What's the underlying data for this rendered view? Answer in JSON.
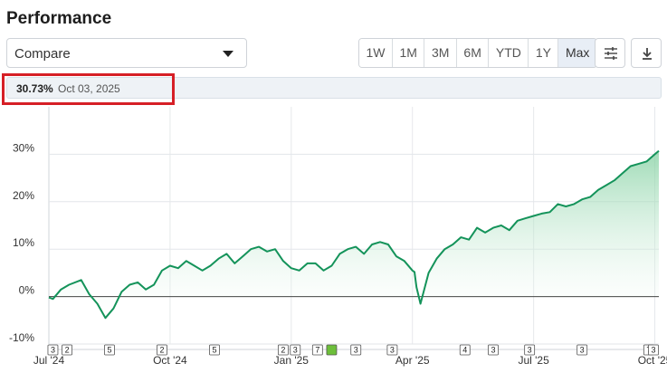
{
  "header": {
    "title": "Performance"
  },
  "compare": {
    "label": "Compare"
  },
  "range_buttons": [
    {
      "label": "1W",
      "active": false
    },
    {
      "label": "1M",
      "active": false
    },
    {
      "label": "3M",
      "active": false
    },
    {
      "label": "6M",
      "active": false
    },
    {
      "label": "YTD",
      "active": false
    },
    {
      "label": "1Y",
      "active": false
    },
    {
      "label": "Max",
      "active": true
    }
  ],
  "toolbar": {
    "settings_icon": "sliders-icon",
    "download_icon": "download-icon"
  },
  "readout": {
    "value": "30.73%",
    "date": "Oct 03, 2025"
  },
  "colors": {
    "line": "#14935a",
    "fill_top": "#7fcf9e",
    "fill_bottom": "#ffffff",
    "zero_line": "#2c2c2c",
    "highlight": "#d61f26",
    "marker_green": "#6dbf3a"
  },
  "chart_data": {
    "type": "area",
    "y_ticks": [
      "30%",
      "20%",
      "10%",
      "0%",
      "-10%"
    ],
    "y_tick_values": [
      30,
      20,
      10,
      0,
      -10
    ],
    "ylim": [
      -10,
      40
    ],
    "x_ticks": [
      "Jul '24",
      "Oct '24",
      "Jan '25",
      "Apr '25",
      "Jul '25",
      "Oct '25"
    ],
    "x_tick_months": [
      0,
      3,
      6,
      9,
      12,
      15
    ],
    "xlim_months": [
      0,
      15.1
    ],
    "grid": true,
    "series": [
      {
        "x_months": [
          0,
          0.1,
          0.3,
          0.5,
          0.8,
          1.0,
          1.2,
          1.4,
          1.6,
          1.8,
          2.0,
          2.2,
          2.4,
          2.6,
          2.8,
          3.0,
          3.2,
          3.4,
          3.6,
          3.8,
          4.0,
          4.2,
          4.4,
          4.6,
          4.8,
          5.0,
          5.2,
          5.4,
          5.6,
          5.8,
          6.0,
          6.2,
          6.4,
          6.6,
          6.8,
          7.0,
          7.2,
          7.4,
          7.6,
          7.8,
          8.0,
          8.2,
          8.4,
          8.6,
          8.8,
          9.0,
          9.05,
          9.1,
          9.2,
          9.4,
          9.6,
          9.8,
          10.0,
          10.2,
          10.4,
          10.6,
          10.8,
          11.0,
          11.2,
          11.4,
          11.6,
          11.8,
          12.0,
          12.2,
          12.4,
          12.6,
          12.8,
          13.0,
          13.2,
          13.4,
          13.6,
          13.8,
          14.0,
          14.2,
          14.4,
          14.6,
          14.8,
          15.0,
          15.1
        ],
        "values": [
          -0.2,
          -0.5,
          1.5,
          2.5,
          3.5,
          0.5,
          -1.5,
          -4.5,
          -2.5,
          1.0,
          2.5,
          3.0,
          1.5,
          2.5,
          5.5,
          6.5,
          6.0,
          7.5,
          6.5,
          5.5,
          6.5,
          8.0,
          9.0,
          7.0,
          8.5,
          10.0,
          10.5,
          9.5,
          10.0,
          7.5,
          6.0,
          5.5,
          7.0,
          7.0,
          5.5,
          6.5,
          9.0,
          10.0,
          10.5,
          9.0,
          11.0,
          11.5,
          11.0,
          8.5,
          7.5,
          5.5,
          5.2,
          2.0,
          -1.5,
          5.0,
          8.0,
          10.0,
          11.0,
          12.5,
          12.0,
          14.5,
          13.5,
          14.5,
          15.0,
          14.0,
          16.0,
          16.5,
          17.0,
          17.5,
          17.8,
          19.5,
          19.0,
          19.5,
          20.5,
          21.0,
          22.5,
          23.5,
          24.5,
          26.0,
          27.5,
          28.0,
          28.5,
          30.0,
          30.73
        ]
      }
    ],
    "event_markers": [
      {
        "label": "3",
        "month": 0.1,
        "green": false
      },
      {
        "label": "2",
        "month": 0.45,
        "green": false
      },
      {
        "label": "5",
        "month": 1.5,
        "green": false
      },
      {
        "label": "2",
        "month": 2.8,
        "green": false
      },
      {
        "label": "5",
        "month": 4.1,
        "green": false
      },
      {
        "label": "2",
        "month": 5.8,
        "green": false
      },
      {
        "label": "3",
        "month": 6.1,
        "green": false
      },
      {
        "label": "7",
        "month": 6.65,
        "green": false
      },
      {
        "label": "",
        "month": 7.0,
        "green": true
      },
      {
        "label": "3",
        "month": 7.6,
        "green": false
      },
      {
        "label": "3",
        "month": 8.5,
        "green": false
      },
      {
        "label": "4",
        "month": 10.3,
        "green": false
      },
      {
        "label": "3",
        "month": 11.0,
        "green": false
      },
      {
        "label": "3",
        "month": 11.9,
        "green": false
      },
      {
        "label": "3",
        "month": 13.2,
        "green": false
      },
      {
        "label": "7",
        "month": 14.85,
        "green": false
      },
      {
        "label": "3",
        "month": 15.15,
        "green": false
      }
    ]
  }
}
